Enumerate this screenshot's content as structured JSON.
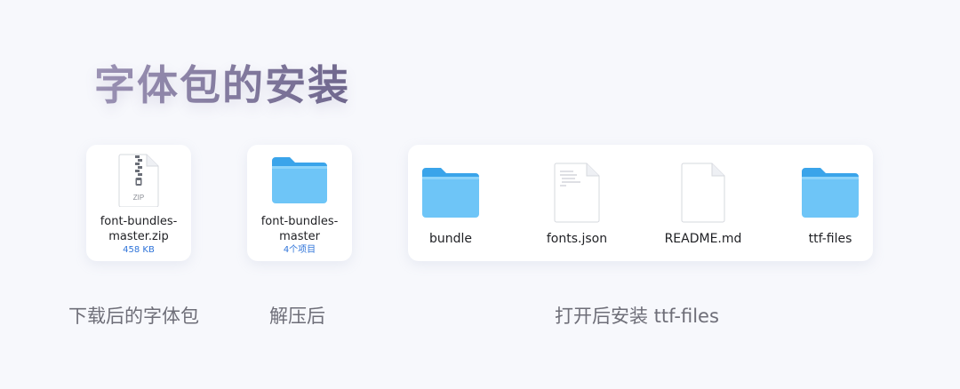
{
  "title": "字体包的安装",
  "items": {
    "zip": {
      "name": "font-bundles-\nmaster.zip",
      "meta": "458 KB",
      "badge": "ZIP"
    },
    "folder": {
      "name": "font-bundles-\nmaster",
      "meta": "4个项目"
    },
    "contents": [
      {
        "name": "bundle",
        "icon": "folder-icon"
      },
      {
        "name": "fonts.json",
        "icon": "json-file-icon"
      },
      {
        "name": "README.md",
        "icon": "md-file-icon"
      },
      {
        "name": "ttf-files",
        "icon": "folder-icon"
      }
    ]
  },
  "captions": {
    "downloaded": "下载后的字体包",
    "extracted": "解压后",
    "open_install": "打开后安装 ttf-files"
  },
  "colors": {
    "folder_light": "#6ec5f7",
    "folder_dark": "#3aa4ea",
    "link_blue": "#2f74d9",
    "background": "#f7f8fc"
  }
}
